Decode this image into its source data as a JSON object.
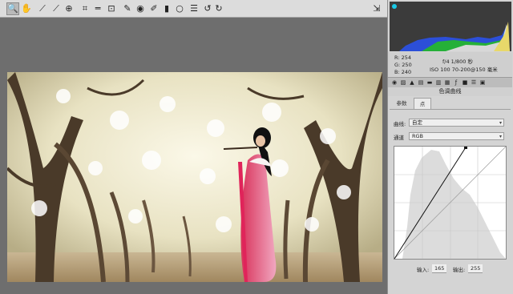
{
  "toolbar": {
    "tools": [
      {
        "name": "zoom-tool",
        "glyph": "🔍"
      },
      {
        "name": "hand-tool",
        "glyph": "✋"
      },
      {
        "name": "white-balance-tool",
        "glyph": "⟋"
      },
      {
        "name": "color-sampler-tool",
        "glyph": "⟋"
      },
      {
        "name": "targeted-adjustment-tool",
        "glyph": "⊕"
      },
      {
        "name": "crop-tool",
        "glyph": "⌗"
      },
      {
        "name": "straighten-tool",
        "glyph": "═"
      },
      {
        "name": "transform-tool",
        "glyph": "⊡"
      },
      {
        "name": "spot-removal-tool",
        "glyph": "✎"
      },
      {
        "name": "red-eye-tool",
        "glyph": "◉"
      },
      {
        "name": "adjustment-brush-tool",
        "glyph": "✐"
      },
      {
        "name": "graduated-filter-tool",
        "glyph": "▮"
      },
      {
        "name": "radial-filter-tool",
        "glyph": "○"
      },
      {
        "name": "preferences-tool",
        "glyph": "☰"
      },
      {
        "name": "rotate-left-tool",
        "glyph": "↺"
      },
      {
        "name": "rotate-right-tool",
        "glyph": "↻"
      }
    ],
    "export_glyph": "⇲"
  },
  "readout": {
    "r": "R:  254",
    "g": "G:  250",
    "b": "B:  240",
    "exposure": "f/4   1/800 秒",
    "lens": "ISO 100   70-200@150 毫米"
  },
  "panel": {
    "section_title": "色调曲线",
    "tabs": [
      "参数",
      "点"
    ],
    "curve_label": "曲线:",
    "curve_value": "自定",
    "channel_label": "通道",
    "channel_value": "RGB",
    "input_label": "输入:",
    "input_value": "165",
    "output_label": "输出:",
    "output_value": "255"
  },
  "colors": {
    "panel_bg": "#d4d4d4",
    "toolbar_bg": "#dcdcdc",
    "canvas_bg": "#6e6e6e"
  }
}
